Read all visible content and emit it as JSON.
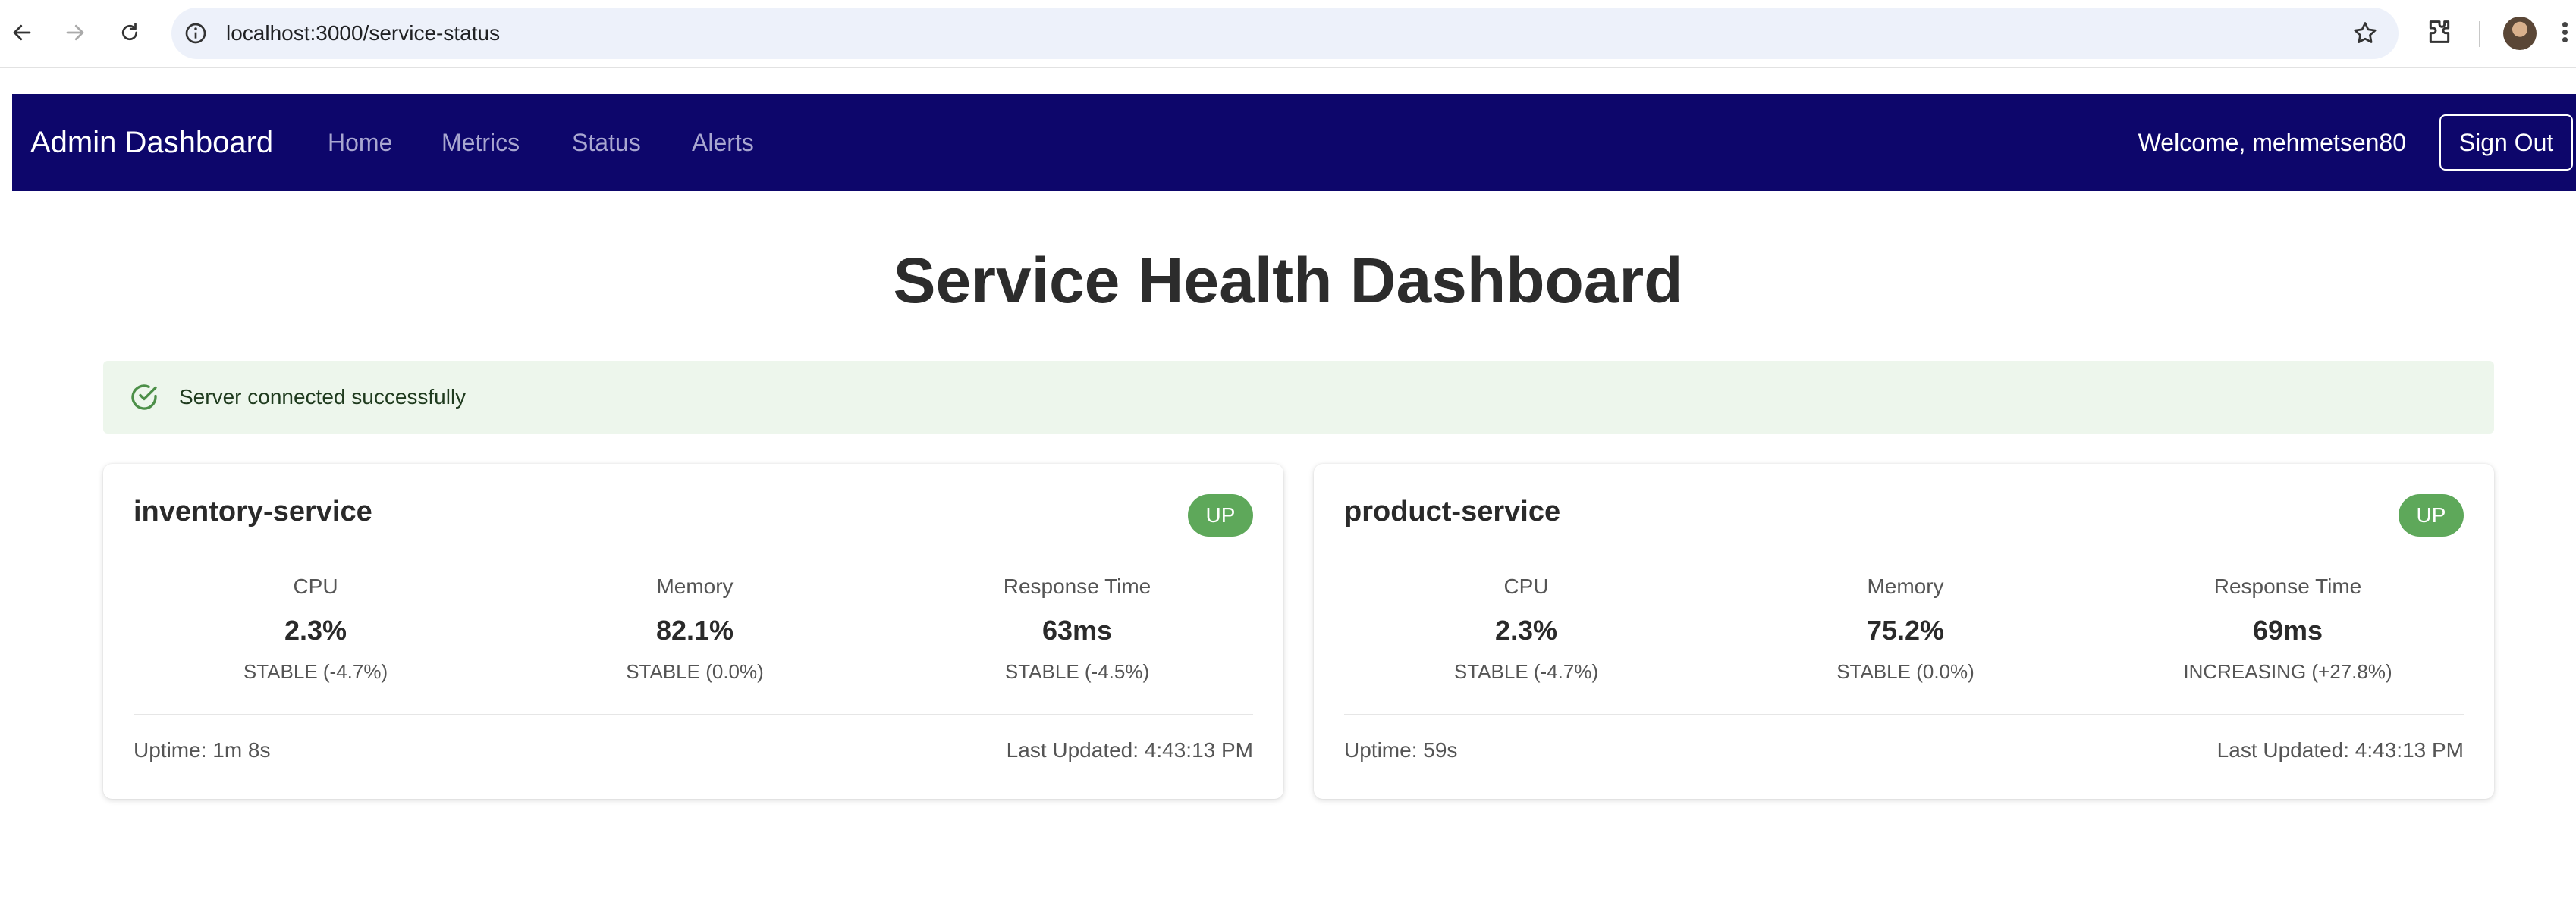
{
  "browser": {
    "url": "localhost:3000/service-status"
  },
  "navbar": {
    "brand": "Admin Dashboard",
    "links": [
      "Home",
      "Metrics",
      "Status",
      "Alerts"
    ],
    "welcome": "Welcome, mehmetsen80",
    "sign_out": "Sign Out",
    "background": "#0d066b"
  },
  "page": {
    "title": "Service Health Dashboard"
  },
  "alert": {
    "message": "Server connected successfully",
    "icon": "check-circle-icon"
  },
  "services": [
    {
      "name": "inventory-service",
      "status": "UP",
      "metrics": [
        {
          "label": "CPU",
          "value": "2.3%",
          "trend": "STABLE (-4.7%)"
        },
        {
          "label": "Memory",
          "value": "82.1%",
          "trend": "STABLE (0.0%)"
        },
        {
          "label": "Response Time",
          "value": "63ms",
          "trend": "STABLE (-4.5%)"
        }
      ],
      "uptime": "Uptime: 1m 8s",
      "last_updated": "Last Updated: 4:43:13 PM"
    },
    {
      "name": "product-service",
      "status": "UP",
      "metrics": [
        {
          "label": "CPU",
          "value": "2.3%",
          "trend": "STABLE (-4.7%)"
        },
        {
          "label": "Memory",
          "value": "75.2%",
          "trend": "STABLE (0.0%)"
        },
        {
          "label": "Response Time",
          "value": "69ms",
          "trend": "INCREASING (+27.8%)"
        }
      ],
      "uptime": "Uptime: 59s",
      "last_updated": "Last Updated: 4:43:13 PM"
    }
  ],
  "colors": {
    "status_up": "#5ea85a",
    "alert_bg": "#edf6ec"
  }
}
